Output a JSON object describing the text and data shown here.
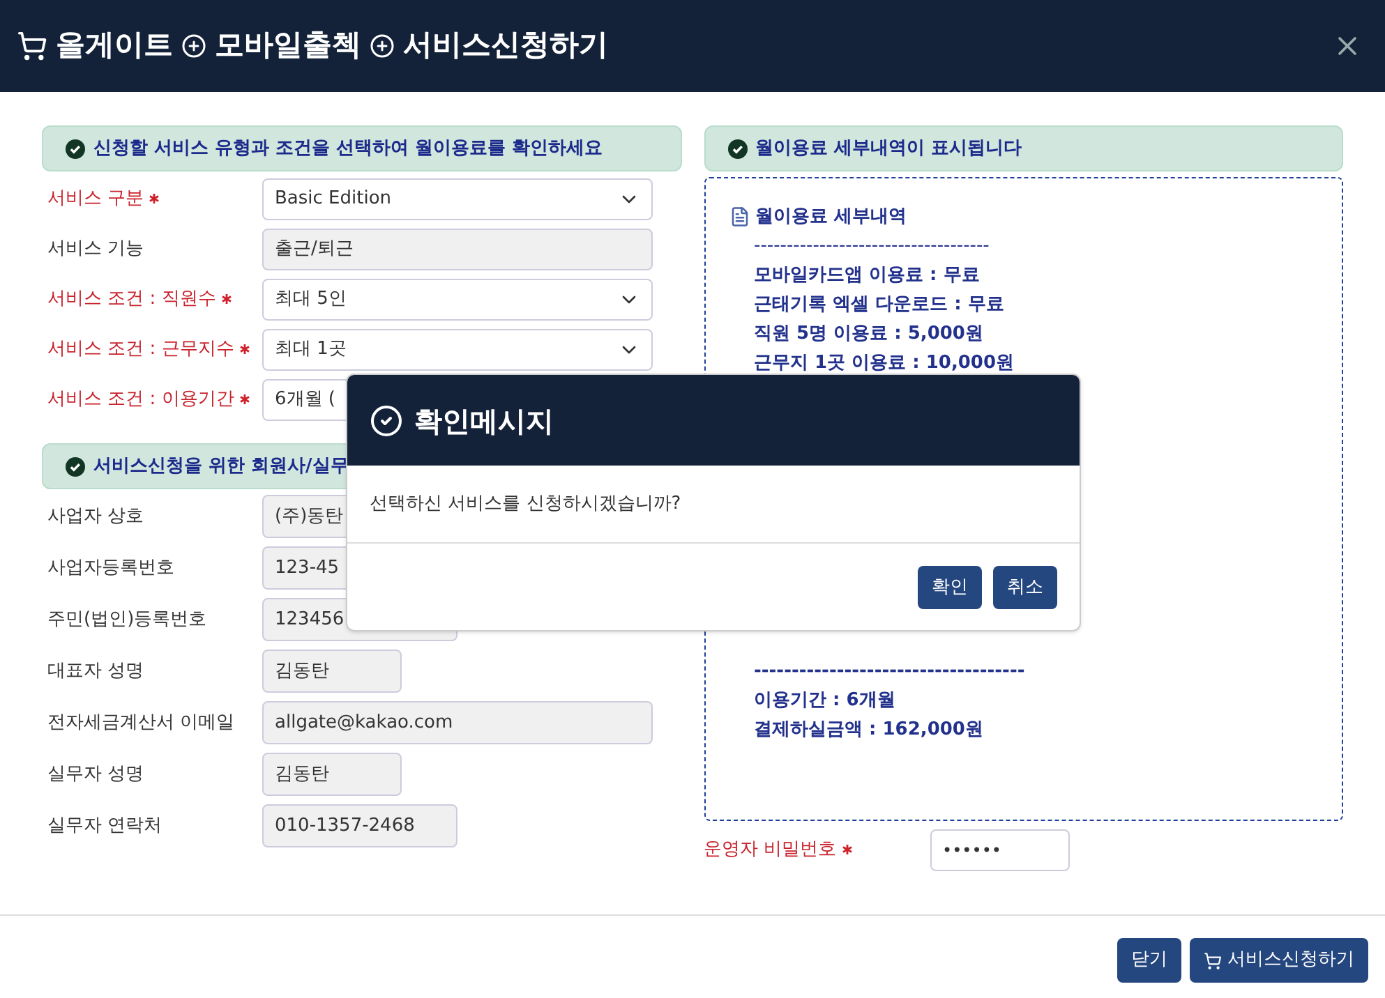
{
  "window": {
    "title_parts": [
      "올게이트",
      "모바일출첵",
      "서비스신청하기"
    ]
  },
  "service_section": {
    "heading": "신청할 서비스 유형과 조건을 선택하여 월이용료를 확인하세요",
    "fields": [
      {
        "label": "서비스 구분",
        "required": true,
        "kind": "select",
        "value": "Basic Edition"
      },
      {
        "label": "서비스 기능",
        "required": false,
        "kind": "readonly",
        "value": "출근/퇴근"
      },
      {
        "label": "서비스 조건 : 직원수",
        "required": true,
        "kind": "select",
        "value": "최대 5인"
      },
      {
        "label": "서비스 조건 : 근무지수",
        "required": true,
        "kind": "select",
        "value": "최대 1곳"
      },
      {
        "label": "서비스 조건 : 이용기간",
        "required": true,
        "kind": "select",
        "value": "6개월 ("
      }
    ]
  },
  "member_section": {
    "heading": "서비스신청을 위한 회원사/실무",
    "fields": [
      {
        "label": "사업자 상호",
        "value": "(주)동탄"
      },
      {
        "label": "사업자등록번호",
        "value": "123-45"
      },
      {
        "label": "주민(법인)등록번호",
        "value": "123456"
      },
      {
        "label": "대표자 성명",
        "value": "김동탄"
      },
      {
        "label": "전자세금계산서 이메일",
        "value": "allgate@kakao.com"
      },
      {
        "label": "실무자 성명",
        "value": "김동탄"
      },
      {
        "label": "실무자 연락처",
        "value": "010-1357-2468"
      }
    ]
  },
  "detail_section": {
    "heading": "월이용료 세부내역이 표시됩니다",
    "title": "월이용료 세부내역",
    "top_lines": [
      "------------------------------------",
      "모바일카드앱 이용료 : 무료",
      "근태기록 엑셀 다운로드 : 무료",
      "직원 5명 이용료 : 5,000원",
      "근무지 1곳 이용료 : 10,000원"
    ],
    "bottom_lines": [
      "------------------------------------",
      "이용기간 : 6개월",
      "결제하실금액 : 162,000원"
    ]
  },
  "password": {
    "label": "운영자 비밀번호",
    "required": true,
    "value": "••••••"
  },
  "footer_buttons": [
    {
      "label": "닫기",
      "kind": "plain"
    },
    {
      "label": "서비스신청하기",
      "kind": "cart"
    }
  ],
  "dialog": {
    "title": "확인메시지",
    "message": "선택하신 서비스를 신청하시겠습니까?",
    "buttons": [
      "확인",
      "취소"
    ]
  }
}
